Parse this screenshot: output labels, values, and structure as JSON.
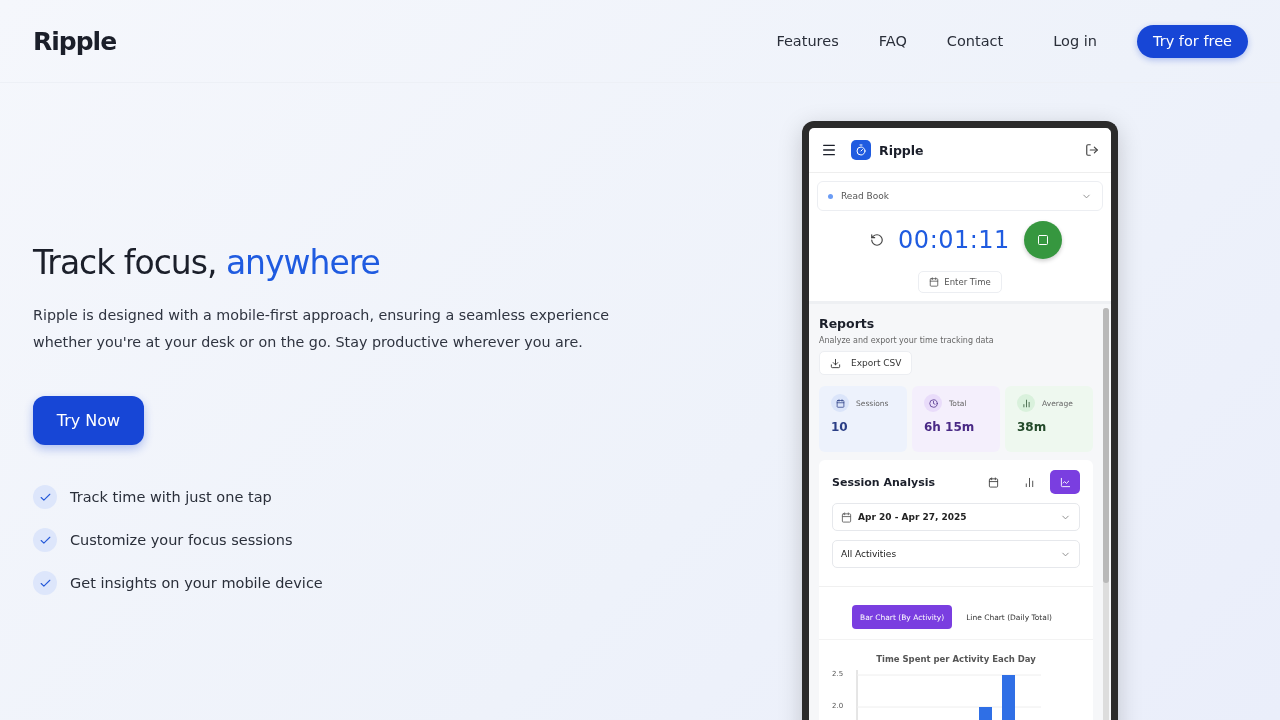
{
  "nav": {
    "brand": "Ripple",
    "links": [
      "Features",
      "FAQ",
      "Contact"
    ],
    "login": "Log in",
    "cta": "Try for free"
  },
  "hero": {
    "title": "Track focus,",
    "title_accent": "anywhere",
    "description": "Ripple is designed with a mobile-first approach, ensuring a seamless experience whether you're at your desk or on the go. Stay productive wherever you are.",
    "button": "Try Now",
    "features": [
      "Track time with just one tap",
      "Customize your focus sessions",
      "Get insights on your mobile device"
    ]
  },
  "phone": {
    "app_name": "Ripple",
    "activity": {
      "name": "Read Book",
      "color": "#6b9cf5"
    },
    "timer": "00:01:11",
    "enter_time": "Enter Time",
    "reports": {
      "title": "Reports",
      "subtitle": "Analyze and export your time tracking data",
      "export": "Export CSV"
    },
    "stats": [
      {
        "kind": "sessions",
        "label": "Sessions",
        "value": "10"
      },
      {
        "kind": "total",
        "label": "Total",
        "value": "6h 15m"
      },
      {
        "kind": "average",
        "label": "Average",
        "value": "38m"
      }
    ],
    "analysis": {
      "title": "Session Analysis",
      "views": [
        {
          "kind": "calendar",
          "selected": false
        },
        {
          "kind": "bars",
          "selected": false
        },
        {
          "kind": "line",
          "selected": true
        }
      ],
      "date_range": "Apr 20 - Apr 27, 2025",
      "filter": "All Activities",
      "chart_tabs": [
        {
          "label": "Bar Chart (By Activity)",
          "selected": true
        },
        {
          "label": "Line Chart (Daily Total)",
          "selected": false
        }
      ],
      "chart_title": "Time Spent per Activity Each Day",
      "y_ticks": [
        "2.5",
        "2.0"
      ]
    }
  }
}
